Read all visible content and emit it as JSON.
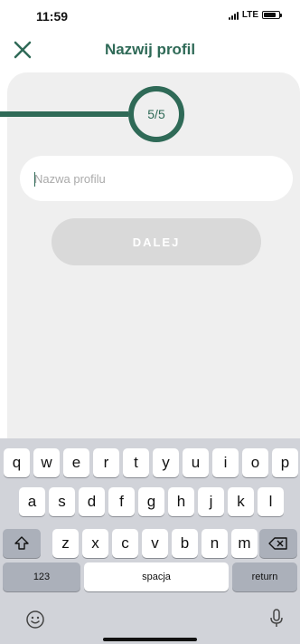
{
  "status": {
    "time": "11:59",
    "network": "LTE"
  },
  "header": {
    "title": "Nazwij profil"
  },
  "progress": {
    "label": "5/5",
    "current": 5,
    "total": 5
  },
  "form": {
    "input_placeholder": "Nazwa profilu",
    "input_value": "",
    "next_label": "DALEJ"
  },
  "keyboard": {
    "row1": [
      "q",
      "w",
      "e",
      "r",
      "t",
      "y",
      "u",
      "i",
      "o",
      "p"
    ],
    "row2": [
      "a",
      "s",
      "d",
      "f",
      "g",
      "h",
      "j",
      "k",
      "l"
    ],
    "row3": [
      "z",
      "x",
      "c",
      "v",
      "b",
      "n",
      "m"
    ],
    "numbers_label": "123",
    "space_label": "spacja",
    "return_label": "return"
  },
  "colors": {
    "accent": "#2f6a57",
    "card_bg": "#efefef",
    "button_disabled": "#d9d9d9",
    "keyboard_bg": "#d1d3d9"
  }
}
